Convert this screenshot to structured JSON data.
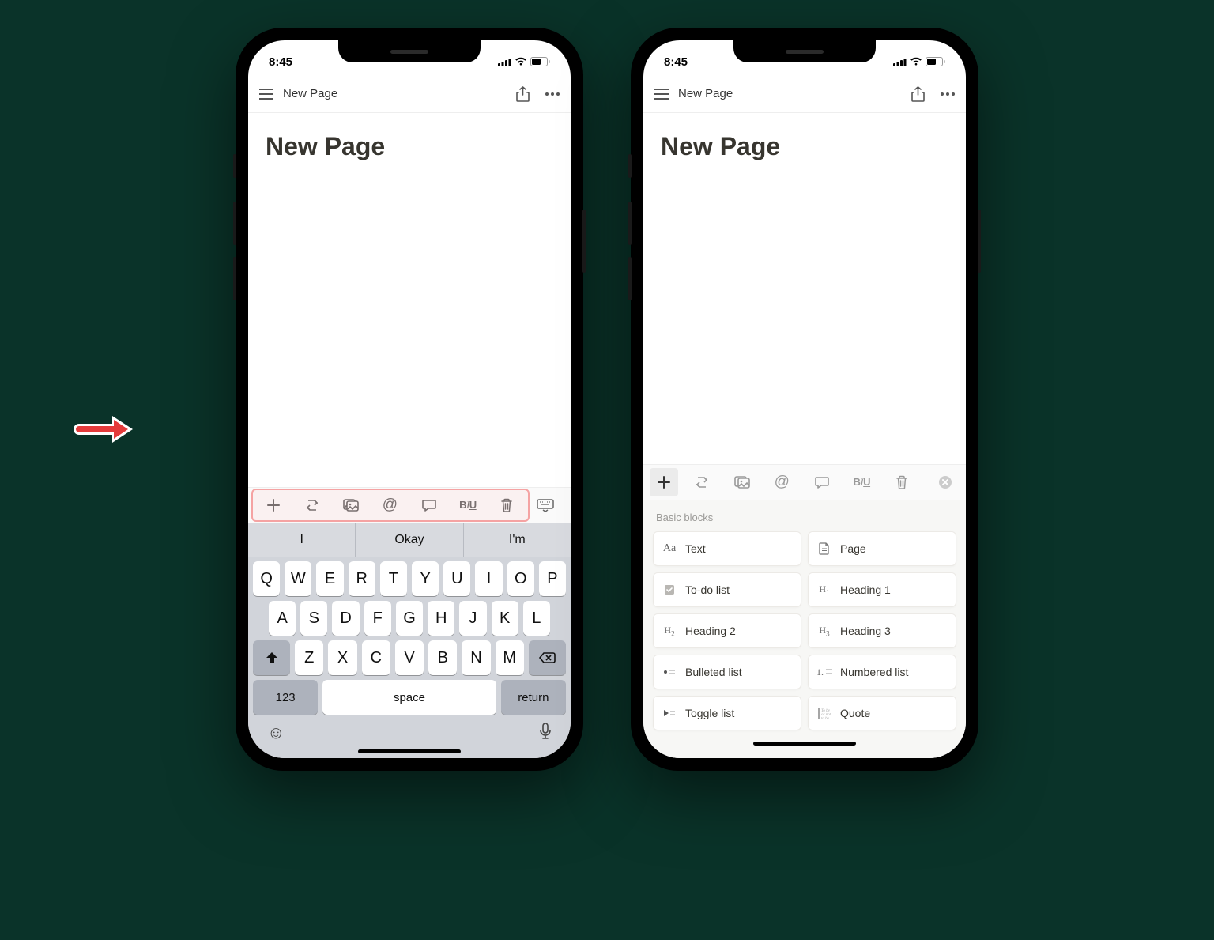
{
  "status": {
    "time": "8:45"
  },
  "nav": {
    "title": "New Page"
  },
  "page": {
    "title": "New Page"
  },
  "keyboard": {
    "suggestions": [
      "I",
      "Okay",
      "I'm"
    ],
    "row1": [
      "Q",
      "W",
      "E",
      "R",
      "T",
      "Y",
      "U",
      "I",
      "O",
      "P"
    ],
    "row2": [
      "A",
      "S",
      "D",
      "F",
      "G",
      "H",
      "J",
      "K",
      "L"
    ],
    "row3": [
      "Z",
      "X",
      "C",
      "V",
      "B",
      "N",
      "M"
    ],
    "numKey": "123",
    "spaceKey": "space",
    "returnKey": "return"
  },
  "blocks": {
    "header": "Basic blocks",
    "items": [
      {
        "icon": "Aa",
        "label": "Text"
      },
      {
        "icon": "page",
        "label": "Page"
      },
      {
        "icon": "todo",
        "label": "To-do list"
      },
      {
        "icon": "H1",
        "label": "Heading 1"
      },
      {
        "icon": "H2",
        "label": "Heading 2"
      },
      {
        "icon": "H3",
        "label": "Heading 3"
      },
      {
        "icon": "bullet",
        "label": "Bulleted list"
      },
      {
        "icon": "1.",
        "label": "Numbered list"
      },
      {
        "icon": "toggle",
        "label": "Toggle list"
      },
      {
        "icon": "quote",
        "label": "Quote"
      }
    ]
  }
}
